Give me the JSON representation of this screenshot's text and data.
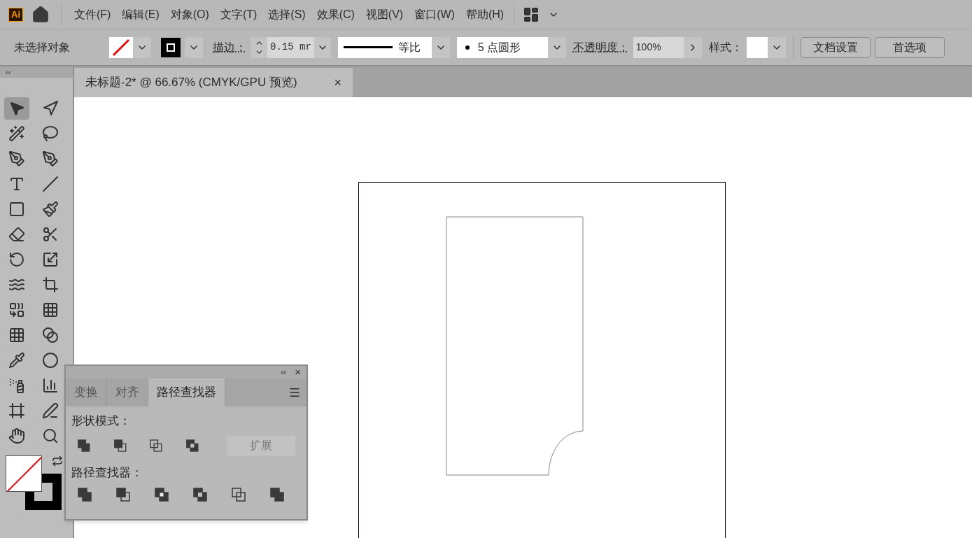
{
  "app": {
    "logo": "Ai"
  },
  "menu": [
    "文件(F)",
    "编辑(E)",
    "对象(O)",
    "文字(T)",
    "选择(S)",
    "效果(C)",
    "视图(V)",
    "窗口(W)",
    "帮助(H)"
  ],
  "control_bar": {
    "selection": "未选择对象",
    "stroke_label": "描边：",
    "stroke_value": "0.15 mr",
    "profile": "等比",
    "brush": "5 点圆形",
    "opacity_label": "不透明度：",
    "opacity_value": "100%",
    "style_label": "样式：",
    "buttons": [
      "文档设置",
      "首选项"
    ]
  },
  "toolbar": {
    "collapse": "‹‹",
    "tools": [
      {
        "selected": true
      },
      {
        "selected": false
      },
      {
        "selected": false
      },
      {
        "selected": false
      },
      {
        "selected": false
      },
      {
        "selected": false
      },
      {
        "selected": false
      },
      {
        "selected": false
      },
      {
        "selected": false
      },
      {
        "selected": false
      },
      {
        "selected": false
      },
      {
        "selected": false
      },
      {
        "selected": false
      },
      {
        "selected": false
      },
      {
        "selected": false
      },
      {
        "selected": false
      },
      {
        "selected": false
      },
      {
        "selected": false
      },
      {
        "selected": false
      },
      {
        "selected": false
      },
      {
        "selected": false
      },
      {
        "selected": false
      },
      {
        "selected": false
      },
      {
        "selected": false
      },
      {
        "selected": false
      },
      {
        "selected": false
      },
      {
        "selected": false
      },
      {
        "selected": false
      }
    ]
  },
  "document_tab": {
    "title": "未标题-2* @ 66.67% (CMYK/GPU 预览)",
    "close": "×"
  },
  "panel": {
    "collapse": "‹‹",
    "close": "×",
    "tabs": [
      {
        "label": "变换",
        "selected": false
      },
      {
        "label": "对齐",
        "selected": false
      },
      {
        "label": "路径查找器",
        "selected": true
      }
    ],
    "shape_modes_label": "形状模式：",
    "expand": {
      "label": "扩展",
      "disabled": true
    },
    "pathfinders_label": "路径查找器："
  }
}
